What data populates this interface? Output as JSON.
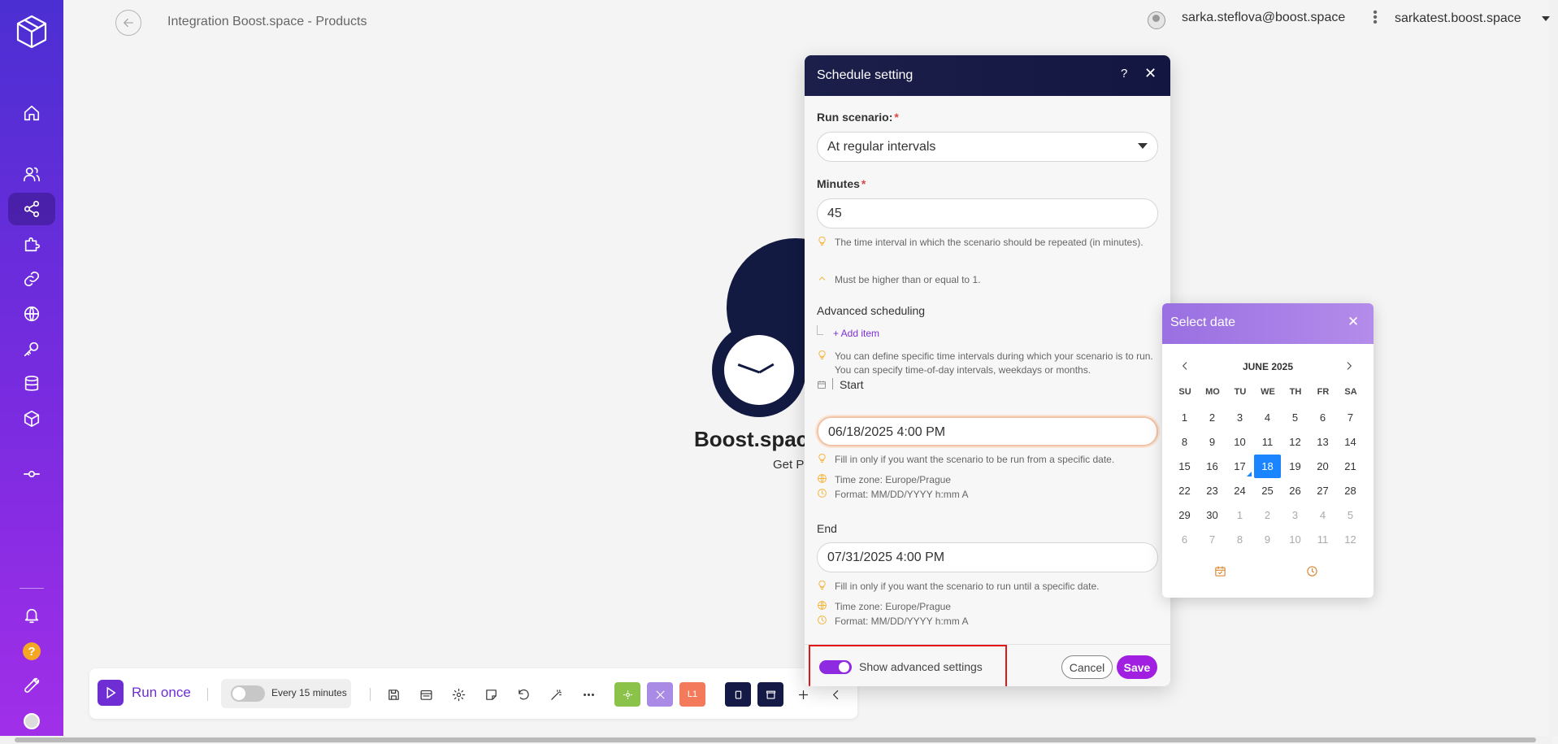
{
  "header": {
    "title": "Integration Boost.space - Products",
    "user_email": "sarka.steflova@boost.space",
    "org_name": "sarkatest.boost.space"
  },
  "canvas": {
    "node_name": "Boost.space",
    "node_subtitle": "Get P"
  },
  "toolbar": {
    "run_once_label": "Run once",
    "schedule_label": "Every 15 minutes",
    "chip_log_label": "L1"
  },
  "modal": {
    "title": "Schedule setting",
    "help_glyph": "?",
    "close_glyph": "✕",
    "run_scenario_label": "Run scenario:",
    "run_scenario_value": "At regular intervals",
    "minutes_label": "Minutes",
    "minutes_value": "45",
    "minutes_hint": "The time interval in which the scenario should be repeated (in minutes).",
    "minutes_rule": "Must be higher than or equal to 1.",
    "advanced_scheduling_label": "Advanced scheduling",
    "add_item_label": "+ Add item",
    "advanced_hint": "You can define specific time intervals during which your scenario is to run. You can specify time-of-day intervals, weekdays or months.",
    "start_label": "Start",
    "start_value": "06/18/2025 4:00 PM",
    "start_hint": "Fill in only if you want the scenario to be run from a specific date.",
    "start_timezone": "Time zone: Europe/Prague",
    "start_format": "Format: MM/DD/YYYY h:mm A",
    "end_label": "End",
    "end_value": "07/31/2025 4:00 PM",
    "end_hint": "Fill in only if you want the scenario to run until a specific date.",
    "end_timezone": "Time zone: Europe/Prague",
    "end_format": "Format: MM/DD/YYYY h:mm A",
    "advanced_toggle_label": "Show advanced settings",
    "cancel_label": "Cancel",
    "save_label": "Save"
  },
  "picker": {
    "title": "Select date",
    "close_glyph": "✕",
    "month": "JUNE 2025",
    "weekdays": [
      "SU",
      "MO",
      "TU",
      "WE",
      "TH",
      "FR",
      "SA"
    ],
    "weeks": [
      [
        {
          "d": "1"
        },
        {
          "d": "2"
        },
        {
          "d": "3"
        },
        {
          "d": "4"
        },
        {
          "d": "5"
        },
        {
          "d": "6"
        },
        {
          "d": "7"
        }
      ],
      [
        {
          "d": "8"
        },
        {
          "d": "9"
        },
        {
          "d": "10"
        },
        {
          "d": "11"
        },
        {
          "d": "12"
        },
        {
          "d": "13"
        },
        {
          "d": "14"
        }
      ],
      [
        {
          "d": "15"
        },
        {
          "d": "16"
        },
        {
          "d": "17",
          "today": true
        },
        {
          "d": "18",
          "selected": true
        },
        {
          "d": "19"
        },
        {
          "d": "20"
        },
        {
          "d": "21"
        }
      ],
      [
        {
          "d": "22"
        },
        {
          "d": "23"
        },
        {
          "d": "24"
        },
        {
          "d": "25"
        },
        {
          "d": "26"
        },
        {
          "d": "27"
        },
        {
          "d": "28"
        }
      ],
      [
        {
          "d": "29"
        },
        {
          "d": "30"
        },
        {
          "d": "1",
          "muted": true
        },
        {
          "d": "2",
          "muted": true
        },
        {
          "d": "3",
          "muted": true
        },
        {
          "d": "4",
          "muted": true
        },
        {
          "d": "5",
          "muted": true
        }
      ],
      [
        {
          "d": "6",
          "muted": true
        },
        {
          "d": "7",
          "muted": true
        },
        {
          "d": "8",
          "muted": true
        },
        {
          "d": "9",
          "muted": true
        },
        {
          "d": "10",
          "muted": true
        },
        {
          "d": "11",
          "muted": true
        },
        {
          "d": "12",
          "muted": true
        }
      ]
    ]
  },
  "icons": {
    "sidebar": [
      "home-icon",
      "users-icon",
      "share-icon",
      "puzzle-icon",
      "link-icon",
      "globe-icon",
      "key-icon",
      "database-icon",
      "cube-icon",
      "commit-icon",
      "bell-icon",
      "help-icon",
      "wrench-icon",
      "avatar"
    ],
    "toolbar": [
      "save-icon",
      "schedule-icon",
      "gear-icon",
      "note-icon",
      "undo-icon",
      "magic-icon",
      "more-icon",
      "plus-icon",
      "chevron-left-icon"
    ]
  },
  "colors": {
    "accent": "#a01fe0",
    "modal_header": "#1b1f4a",
    "picker_header": "#9a6fe2",
    "selected_day": "#1b84ff",
    "highlight_box": "#e11818"
  }
}
